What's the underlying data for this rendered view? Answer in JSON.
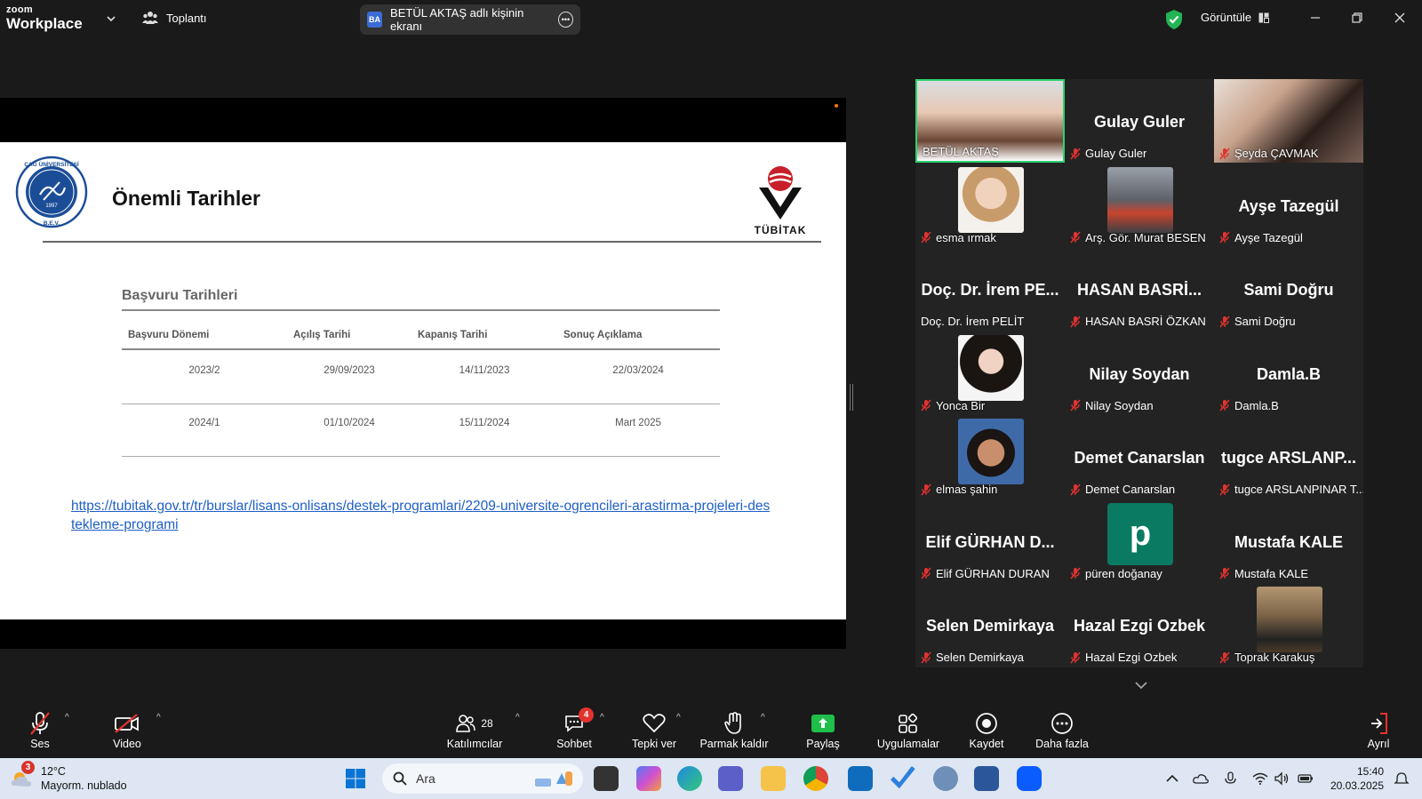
{
  "topbar": {
    "logo_line1": "zoom",
    "logo_line2": "Workplace",
    "meeting_label": "Toplantı",
    "share_initials": "BA",
    "share_label": "BETÜL AKTAŞ adlı kişinin ekranı",
    "view_label": "Görüntüle"
  },
  "slide": {
    "title": "Önemli Tarihler",
    "table_title": "Başvuru Tarihleri",
    "headers": [
      "Başvuru Dönemi",
      "Açılış Tarihi",
      "Kapanış Tarihi",
      "Sonuç Açıklama"
    ],
    "rows": [
      [
        "2023/2",
        "29/09/2023",
        "14/11/2023",
        "22/03/2024"
      ],
      [
        "2024/1",
        "01/10/2024",
        "15/11/2024",
        "Mart 2025"
      ]
    ],
    "link": "https://tubitak.gov.tr/tr/burslar/lisans-onlisans/destek-programlari/2209-universite-ogrencileri-arastirma-projeleri-destekleme-programi",
    "seal_top": "ÇAĞ ÜNİVERSİTESİ",
    "seal_year": "1997",
    "seal_bottom": "B.E.V.",
    "tubitak_word": "TÜBİTAK"
  },
  "gallery": {
    "tiles": [
      {
        "big": "",
        "name": "BETÜL AKTAŞ",
        "muted": false,
        "photo": "woman-brown-hair",
        "active": true
      },
      {
        "big": "Gulay Guler",
        "name": "Gulay Guler",
        "muted": true
      },
      {
        "big": "",
        "name": "Şeyda ÇAVMAK",
        "muted": true,
        "photo": "woman-dark-hair"
      },
      {
        "big": "",
        "name": "esma ırmak",
        "muted": true,
        "photo": "woman-blonde"
      },
      {
        "big": "",
        "name": "Arş. Gör. Murat BESEN",
        "muted": true,
        "photo": "street"
      },
      {
        "big": "Ayşe Tazegül",
        "name": "Ayşe Tazegül",
        "muted": true
      },
      {
        "big": "Doç. Dr. İrem PE...",
        "name": "Doç. Dr. İrem PELİT",
        "muted": false
      },
      {
        "big": "HASAN BASRİ...",
        "name": "HASAN BASRİ ÖZKAN",
        "muted": true
      },
      {
        "big": "Sami Doğru",
        "name": "Sami Doğru",
        "muted": true
      },
      {
        "big": "",
        "name": "Yonca Bir",
        "muted": true,
        "photo": "woman-black-hair"
      },
      {
        "big": "Nilay Soydan",
        "name": "Nilay Soydan",
        "muted": true
      },
      {
        "big": "Damla.B",
        "name": "Damla.B",
        "muted": true
      },
      {
        "big": "",
        "name": "elmas şahin",
        "muted": true,
        "photo": "woman-short-hair"
      },
      {
        "big": "Demet Canarslan",
        "name": "Demet Canarslan",
        "muted": true
      },
      {
        "big": "tugce ARSLANP...",
        "name": "tugce ARSLANPINAR T...",
        "muted": true
      },
      {
        "big": "Elif GÜRHAN D...",
        "name": "Elif GÜRHAN DURAN",
        "muted": true
      },
      {
        "big": "",
        "name": "püren doğanay",
        "muted": true,
        "letter": "p"
      },
      {
        "big": "Mustafa KALE",
        "name": "Mustafa KALE",
        "muted": true
      },
      {
        "big": "Selen Demirkaya",
        "name": "Selen Demirkaya",
        "muted": true
      },
      {
        "big": "Hazal Ezgi Ozbek",
        "name": "Hazal Ezgi Ozbek",
        "muted": true
      },
      {
        "big": "",
        "name": "Toprak Karakuş",
        "muted": true,
        "photo": "man-outdoor"
      }
    ]
  },
  "toolbar": {
    "audio": "Ses",
    "video": "Video",
    "participants": "Katılımcılar",
    "participant_count": "28",
    "chat": "Sohbet",
    "chat_badge": "4",
    "react": "Tepki ver",
    "raise_hand": "Parmak kaldır",
    "share": "Paylaş",
    "apps": "Uygulamalar",
    "record": "Kaydet",
    "more": "Daha fazla",
    "leave": "Ayrıl"
  },
  "taskbar": {
    "weather_badge": "3",
    "temp": "12°C",
    "weather_desc": "Mayorm. nublado",
    "search_placeholder": "Ara",
    "time": "15:40",
    "date": "20.03.2025"
  },
  "colors": {
    "active_border": "#2dd36f",
    "muted_red": "#e2332f",
    "link_blue": "#1f5fc6",
    "share_green": "#1fbf4a"
  }
}
